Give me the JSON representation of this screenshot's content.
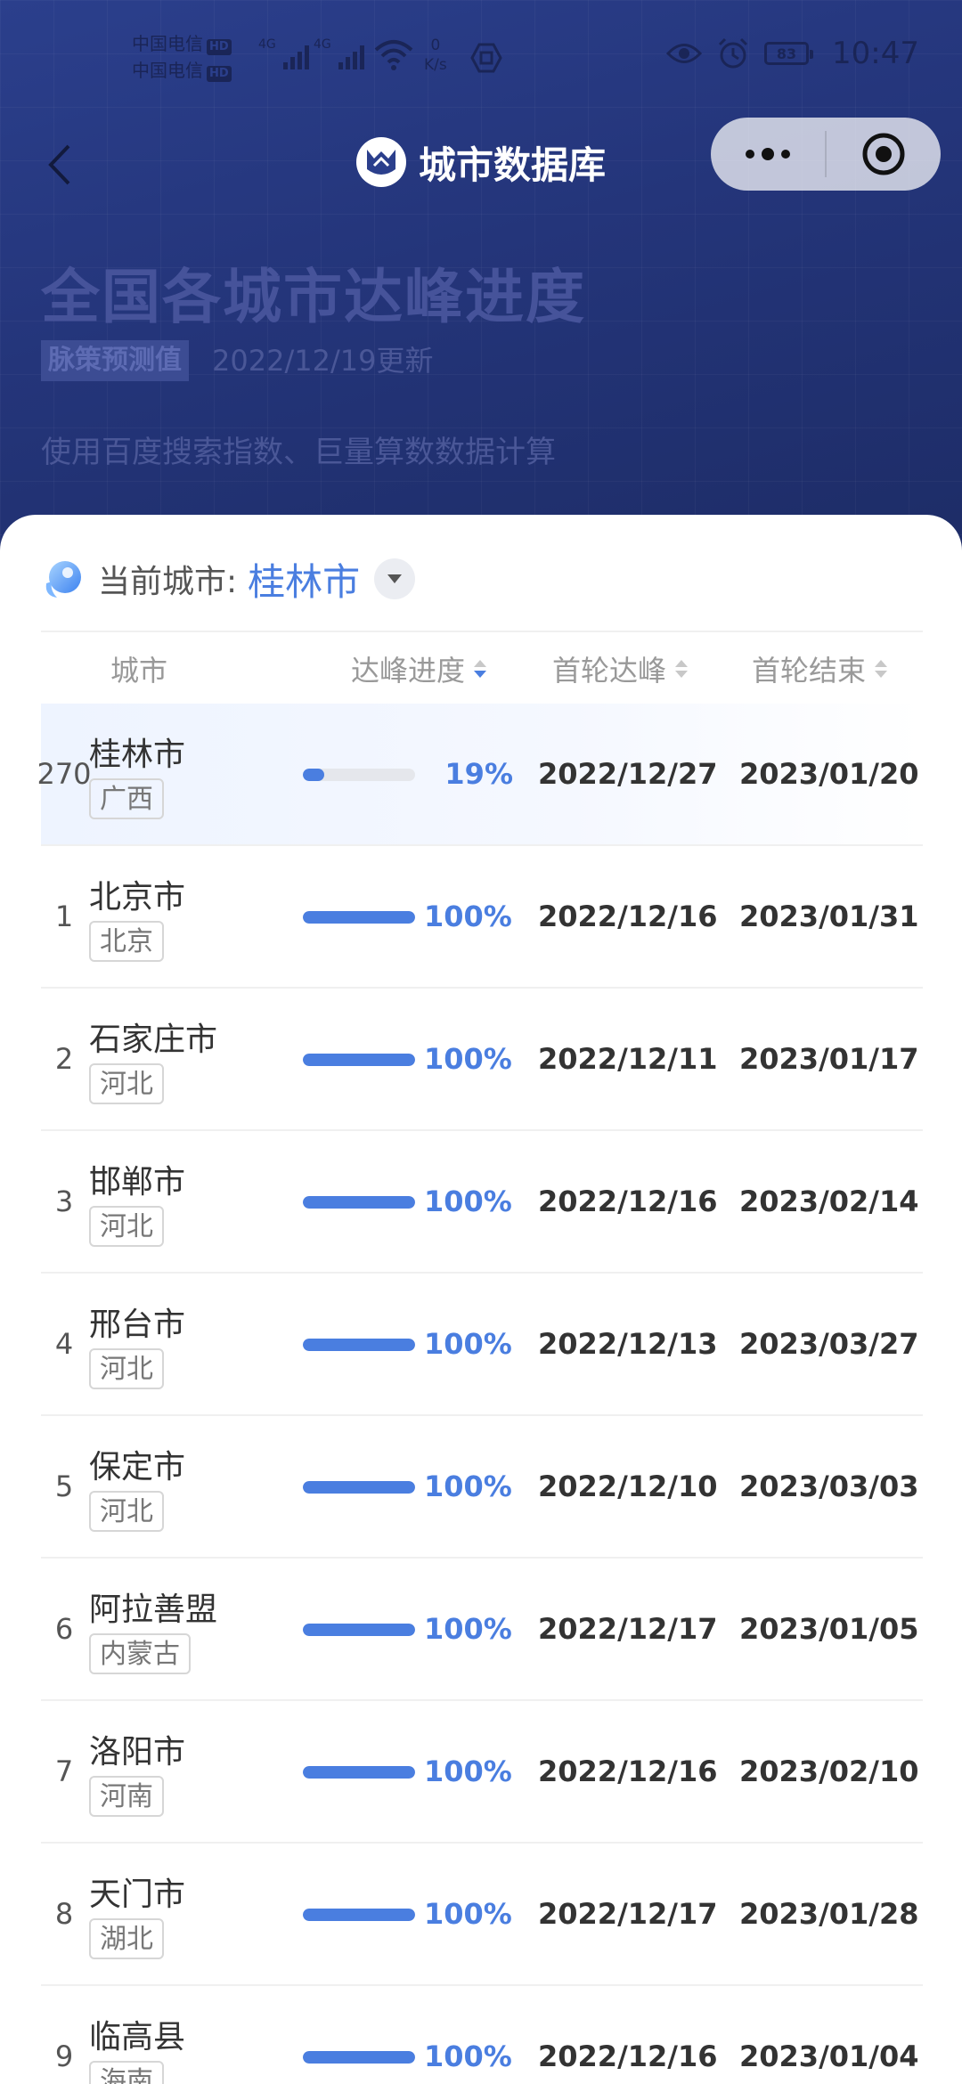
{
  "status_bar": {
    "carrier_1": "中国电信",
    "carrier_2": "中国电信",
    "hd": "HD",
    "net": "4G",
    "speed_value": "0",
    "speed_unit": "K/s",
    "battery": "83",
    "time": "10:47"
  },
  "nav": {
    "title": "城市数据库"
  },
  "hero": {
    "title": "全国各城市达峰进度",
    "badge": "脉策预测值",
    "updated": "2022/12/19更新",
    "description": "使用百度搜索指数、巨量算数数据计算"
  },
  "current_city": {
    "label": "当前城市:",
    "value": "桂林市"
  },
  "table": {
    "headers": {
      "city": "城市",
      "progress": "达峰进度",
      "first_peak": "首轮达峰",
      "first_end": "首轮结束"
    },
    "rows": [
      {
        "rank": "270",
        "city": "桂林市",
        "province": "广西",
        "progress": 19,
        "progress_label": "19%",
        "peak": "2022/12/27",
        "end": "2023/01/20"
      },
      {
        "rank": "1",
        "city": "北京市",
        "province": "北京",
        "progress": 100,
        "progress_label": "100%",
        "peak": "2022/12/16",
        "end": "2023/01/31"
      },
      {
        "rank": "2",
        "city": "石家庄市",
        "province": "河北",
        "progress": 100,
        "progress_label": "100%",
        "peak": "2022/12/11",
        "end": "2023/01/17"
      },
      {
        "rank": "3",
        "city": "邯郸市",
        "province": "河北",
        "progress": 100,
        "progress_label": "100%",
        "peak": "2022/12/16",
        "end": "2023/02/14"
      },
      {
        "rank": "4",
        "city": "邢台市",
        "province": "河北",
        "progress": 100,
        "progress_label": "100%",
        "peak": "2022/12/13",
        "end": "2023/03/27"
      },
      {
        "rank": "5",
        "city": "保定市",
        "province": "河北",
        "progress": 100,
        "progress_label": "100%",
        "peak": "2022/12/10",
        "end": "2023/03/03"
      },
      {
        "rank": "6",
        "city": "阿拉善盟",
        "province": "内蒙古",
        "progress": 100,
        "progress_label": "100%",
        "peak": "2022/12/17",
        "end": "2023/01/05"
      },
      {
        "rank": "7",
        "city": "洛阳市",
        "province": "河南",
        "progress": 100,
        "progress_label": "100%",
        "peak": "2022/12/16",
        "end": "2023/02/10"
      },
      {
        "rank": "8",
        "city": "天门市",
        "province": "湖北",
        "progress": 100,
        "progress_label": "100%",
        "peak": "2022/12/17",
        "end": "2023/01/28"
      },
      {
        "rank": "9",
        "city": "临高县",
        "province": "海南",
        "progress": 100,
        "progress_label": "100%",
        "peak": "2022/12/16",
        "end": "2023/01/04"
      }
    ]
  },
  "colors": {
    "accent": "#4a7ee0",
    "hero_bg": "#24357a"
  }
}
